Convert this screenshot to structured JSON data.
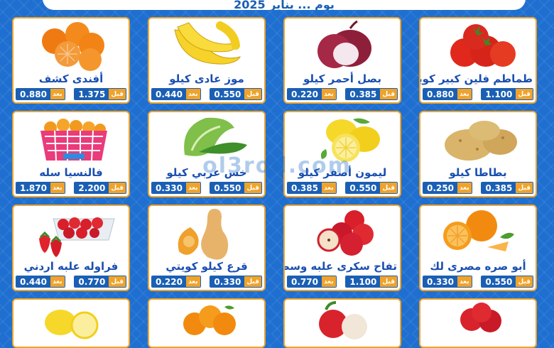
{
  "banner": {
    "text": "يوم ... يناير 2025"
  },
  "watermark": "ol3rod.com",
  "labels": {
    "before": "قبل",
    "after": "بعد"
  },
  "products": [
    {
      "name": "طماطم فلين كبير كويتي",
      "before": "1.100",
      "after": "0.880",
      "icon": "tomato-icon"
    },
    {
      "name": "بصل أحمر كيلو",
      "before": "0.385",
      "after": "0.220",
      "icon": "red-onion-icon"
    },
    {
      "name": "موز عادى كيلو",
      "before": "0.550",
      "after": "0.440",
      "icon": "banana-icon"
    },
    {
      "name": "أفندى كشف",
      "before": "1.375",
      "after": "0.880",
      "icon": "mandarin-icon"
    },
    {
      "name": "بطاطا كيلو",
      "before": "0.385",
      "after": "0.250",
      "icon": "potato-icon"
    },
    {
      "name": "ليمون أصفر كيلو",
      "before": "0.550",
      "after": "0.385",
      "icon": "lemon-icon"
    },
    {
      "name": "خس عربي كيلو",
      "before": "0.550",
      "after": "0.330",
      "icon": "lettuce-icon"
    },
    {
      "name": "فالنسيا سله",
      "before": "2.200",
      "after": "1.870",
      "icon": "orange-basket-icon"
    },
    {
      "name": "أبو صره مصرى لك",
      "before": "0.550",
      "after": "0.330",
      "icon": "navel-orange-icon"
    },
    {
      "name": "تفاح سكرى علبه وسط",
      "before": "1.100",
      "after": "0.770",
      "icon": "red-apple-icon"
    },
    {
      "name": "قرع كيلو كويتي",
      "before": "0.330",
      "after": "0.220",
      "icon": "butternut-squash-icon"
    },
    {
      "name": "فراوله علبه اردني",
      "before": "0.770",
      "after": "0.440",
      "icon": "strawberry-box-icon"
    }
  ]
}
